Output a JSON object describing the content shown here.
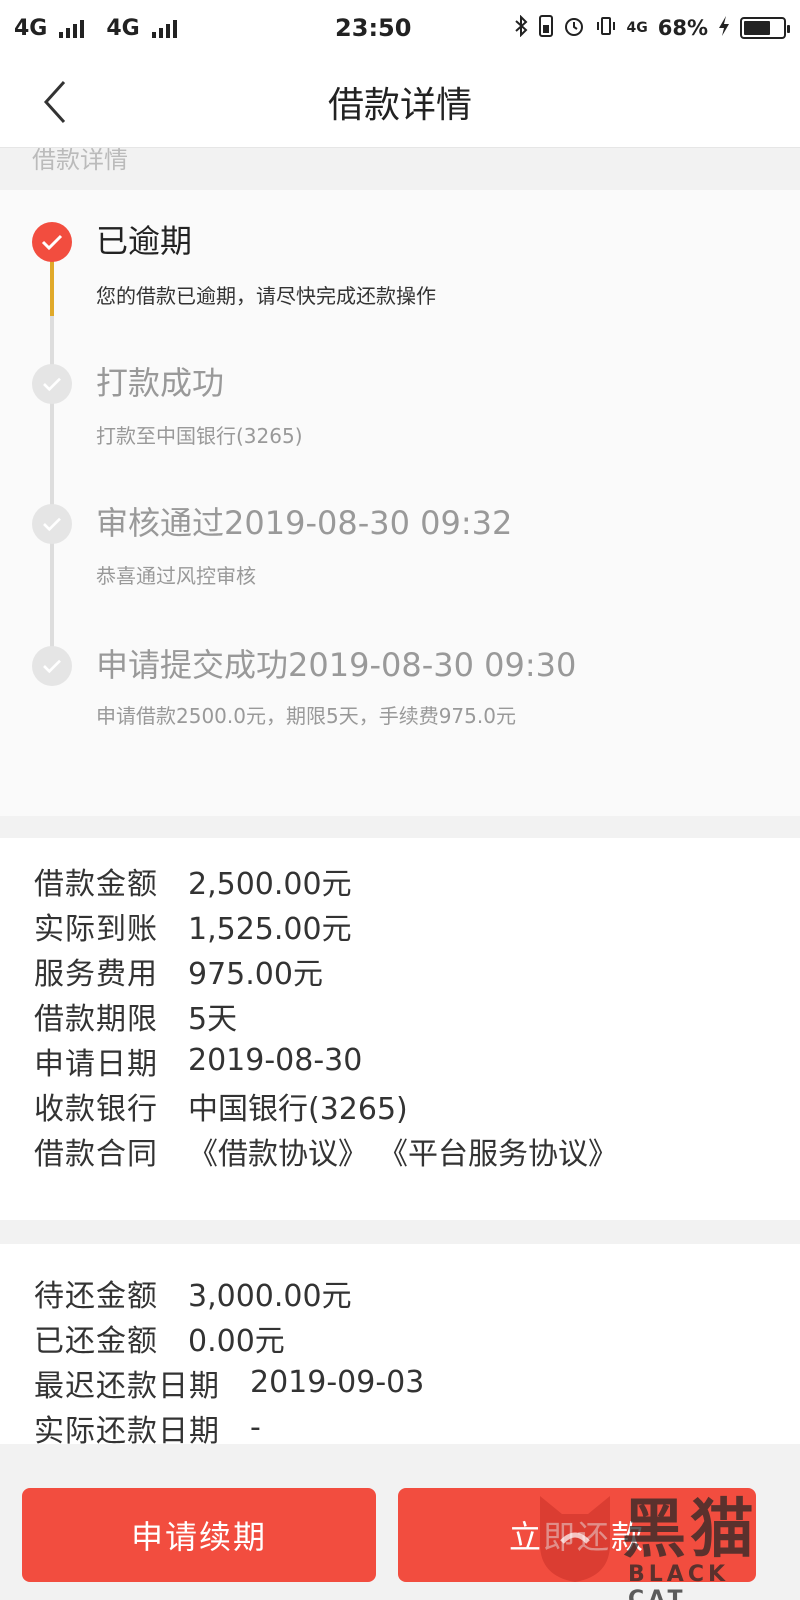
{
  "status_bar": {
    "network1": "4G",
    "network2": "4G",
    "time": "23:50",
    "network3": "4G",
    "battery": "68%",
    "battery_level": 0.68
  },
  "nav": {
    "title": "借款详情"
  },
  "section_label": "借款详情",
  "timeline": [
    {
      "title": "已逾期",
      "desc": "您的借款已逾期，请尽快完成还款操作",
      "state": "active"
    },
    {
      "title": "打款成功",
      "desc": "打款至中国银行(3265)",
      "state": "done"
    },
    {
      "title": "审核通过2019-08-30 09:32",
      "desc": "恭喜通过风控审核",
      "state": "done"
    },
    {
      "title": "申请提交成功2019-08-30 09:30",
      "desc": "申请借款2500.0元，期限5天，手续费975.0元",
      "state": "done"
    }
  ],
  "loan_info": {
    "amount_label": "借款金额",
    "amount": "2,500.00元",
    "received_label": "实际到账",
    "received": "1,525.00元",
    "fee_label": "服务费用",
    "fee": "975.00元",
    "term_label": "借款期限",
    "term": "5天",
    "date_label": "申请日期",
    "date": "2019-08-30",
    "bank_label": "收款银行",
    "bank": "中国银行(3265)",
    "contract_label": "借款合同",
    "contract1": "《借款协议》",
    "contract2": "《平台服务协议》"
  },
  "repay_info": {
    "due_label": "待还金额",
    "due": "3,000.00元",
    "paid_label": "已还金额",
    "paid": "0.00元",
    "deadline_label": "最迟还款日期",
    "deadline": "2019-09-03",
    "actual_label": "实际还款日期",
    "actual": "-"
  },
  "buttons": {
    "extend": "申请续期",
    "repay": "立即还款"
  },
  "watermark": {
    "text": "黑猫",
    "sub": "BLACK CAT"
  },
  "colors": {
    "accent": "#f24d3f",
    "timeline_active": "#e0a92a"
  }
}
